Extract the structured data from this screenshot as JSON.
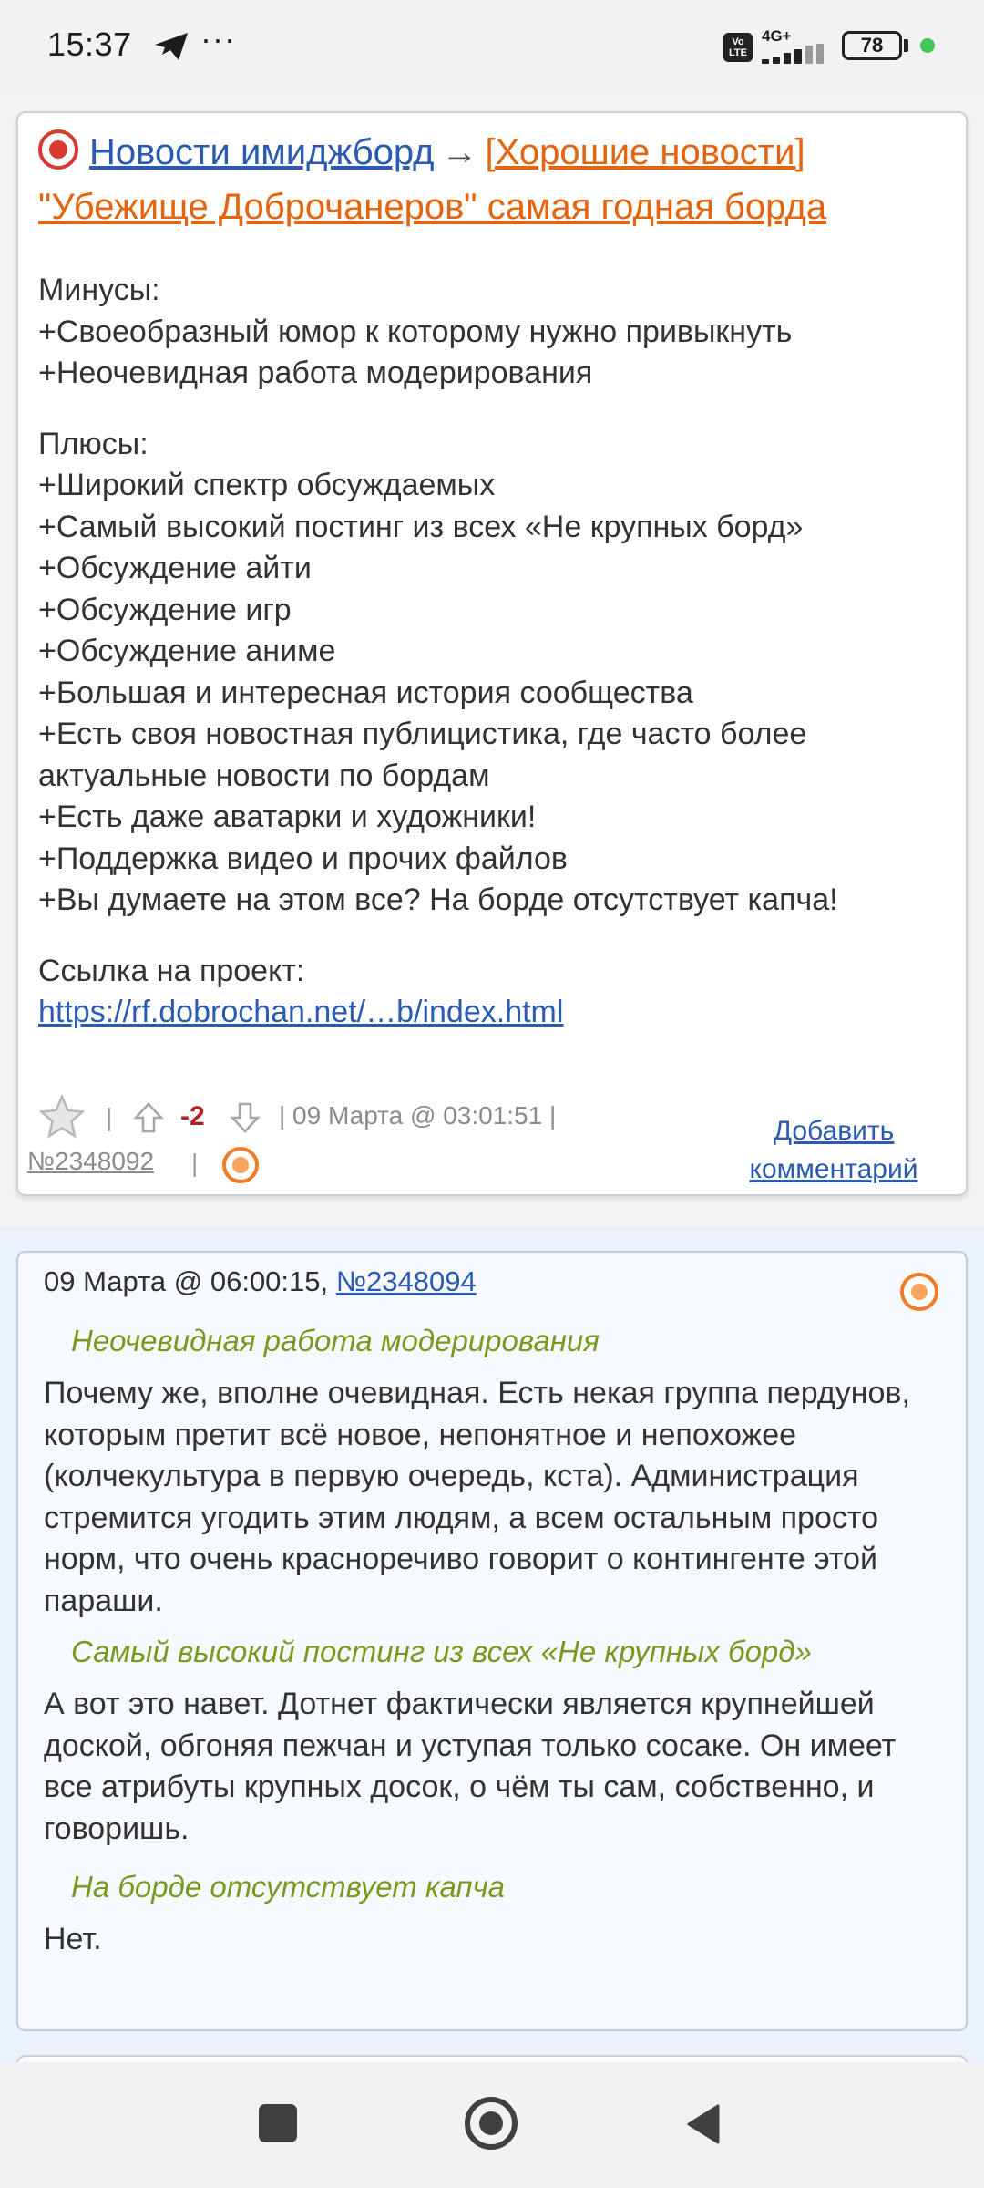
{
  "status_bar": {
    "time": "15:37",
    "dots": "···",
    "volte_top": "Vo",
    "volte_bottom": "LTE",
    "network": "4G+",
    "battery": "78",
    "icons": [
      "telegram-send-icon",
      "volte-icon",
      "signal-icon",
      "battery-icon",
      "privacy-dot-icon"
    ]
  },
  "post": {
    "board_name": "Новости имиджборд",
    "arrow": "→",
    "tag": "[Хорошие новости]",
    "title": "\"Убежище Доброчанеров\" самая годная борда",
    "minus_header": "Минусы:",
    "minuses": [
      "+Своеобразный юмор к которому нужно привыкнуть",
      "+Неочевидная работа модерирования"
    ],
    "plus_header": "Плюсы:",
    "pluses": [
      "+Широкий спектр обсуждаемых",
      "+Самый высокий постинг из всех «Не крупных борд»",
      "+Обсуждение айти",
      "+Обсуждение игр",
      "+Обсуждение аниме",
      "+Большая и интересная история сообщества",
      "+Есть своя новостная публицистика, где часто более актуальные новости по бордам",
      "+Есть даже аватарки и художники!",
      "+Поддержка видео и прочих файлов",
      "+Вы думаете на этом все? На борде отсутствует капча!"
    ],
    "link_header": "Ссылка на проект:",
    "link_text": "https://rf.dobrochan.net/…b/index.html",
    "footer": {
      "sep": "|",
      "score": "-2",
      "date": "| 09 Марта @ 03:01:51 |",
      "number": "№2348092",
      "add_comment_line1": "Добавить",
      "add_comment_line2": "комментарий"
    }
  },
  "comment": {
    "date": "09 Марта @ 06:00:15, ",
    "number": "№2348094",
    "quote1": "Неочевидная работа модерирования",
    "text1": "Почему же, вполне очевидная. Есть некая группа пердунов, которым претит всё новое, непонятное и непохожее (колчекультура в первую очередь, кста). Администрация стремится угодить этим людям, а всем остальным просто норм, что очень красноречиво говорит о контингенте этой параши.",
    "quote2": "Самый высокий постинг из всех «Не крупных борд»",
    "text2": "А вот это навет. Дотнет фактически является крупнейшей доской, обгоняя пежчан и уступая только сосаке. Он имеет все атрибуты крупных досок, о чём ты сам, собственно, и говоришь.",
    "quote3": "На борде отсутствует капча",
    "text3": "Нет."
  },
  "colors": {
    "link_blue": "#2a5bb0",
    "link_orange": "#e3650f",
    "quote_green": "#789a1f",
    "score_red": "#b22222"
  }
}
